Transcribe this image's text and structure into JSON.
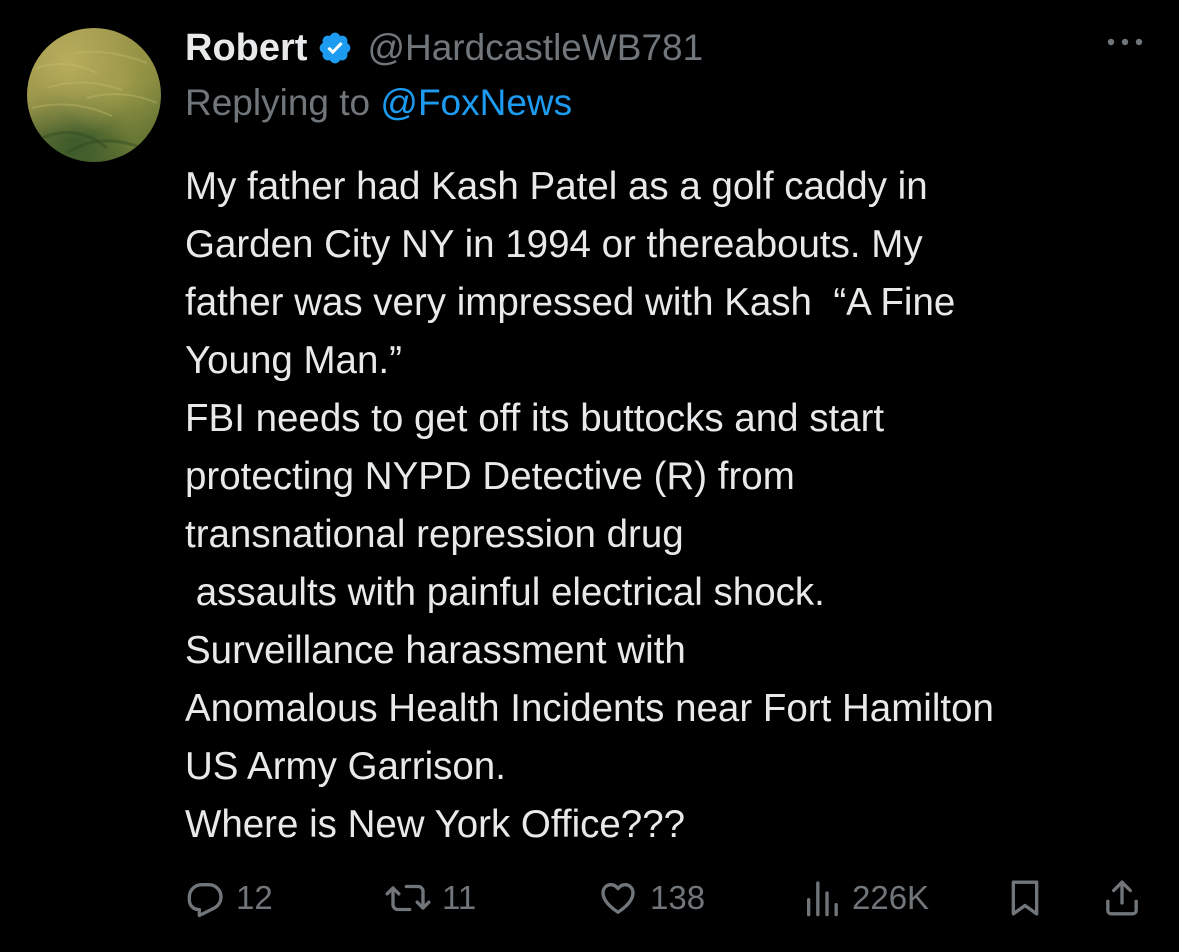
{
  "tweet": {
    "display_name": "Robert",
    "handle": "@HardcastleWB781",
    "replying_prefix": "Replying to ",
    "replying_to": "@FoxNews",
    "lines": [
      "My father had Kash Patel as a golf caddy in",
      "Garden City NY in 1994 or thereabouts. My",
      "father was very impressed with Kash  “A Fine",
      "Young Man.”",
      "FBI needs to get off its buttocks and start",
      "protecting NYPD Detective (R) from",
      "transnational repression drug",
      " assaults with painful electrical shock.",
      "Surveillance harassment with",
      "Anomalous Health Incidents near Fort Hamilton",
      "US Army Garrison.",
      "Where is New York Office???"
    ]
  },
  "actions": {
    "replies": "12",
    "reposts": "11",
    "likes": "138",
    "views": "226K"
  },
  "icons": {
    "avatar": "avatar-grass-photo",
    "verified": "verified-badge-icon",
    "more": "more-options-icon",
    "reply": "reply-icon",
    "repost": "repost-icon",
    "like": "heart-icon",
    "views": "views-icon",
    "bookmark": "bookmark-icon",
    "share": "share-icon"
  },
  "colors": {
    "background": "#000000",
    "text": "#e7e9ea",
    "muted": "#71767b",
    "accent": "#1d9bf0"
  }
}
